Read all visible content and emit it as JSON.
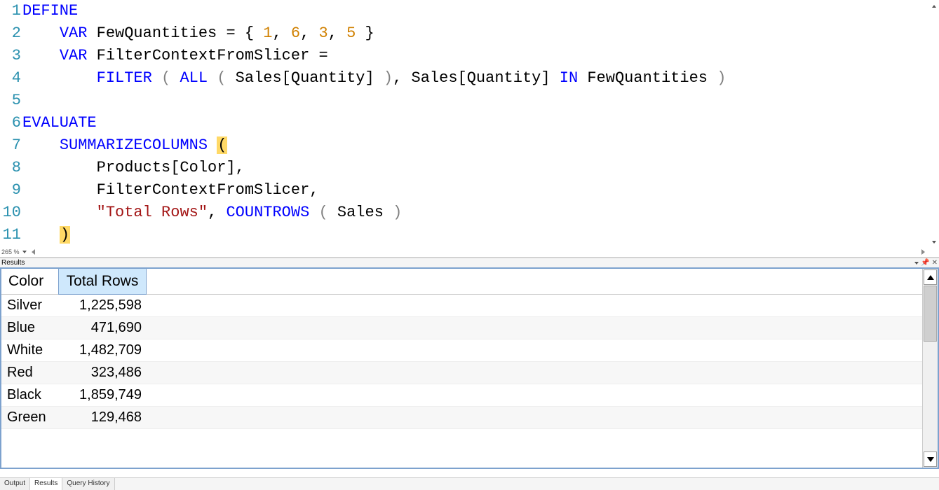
{
  "editor": {
    "zoom": "265 %",
    "lines": [
      {
        "n": 1,
        "tokens": [
          {
            "t": "DEFINE",
            "c": "kw"
          }
        ]
      },
      {
        "n": 2,
        "tokens": [
          {
            "t": "    ",
            "c": ""
          },
          {
            "t": "VAR",
            "c": "kw"
          },
          {
            "t": " FewQuantities = { ",
            "c": ""
          },
          {
            "t": "1",
            "c": "num"
          },
          {
            "t": ", ",
            "c": ""
          },
          {
            "t": "6",
            "c": "num"
          },
          {
            "t": ", ",
            "c": ""
          },
          {
            "t": "3",
            "c": "num"
          },
          {
            "t": ", ",
            "c": ""
          },
          {
            "t": "5",
            "c": "num"
          },
          {
            "t": " }",
            "c": ""
          }
        ]
      },
      {
        "n": 3,
        "tokens": [
          {
            "t": "    ",
            "c": ""
          },
          {
            "t": "VAR",
            "c": "kw"
          },
          {
            "t": " FilterContextFromSlicer =",
            "c": ""
          }
        ]
      },
      {
        "n": 4,
        "tokens": [
          {
            "t": "        ",
            "c": ""
          },
          {
            "t": "FILTER",
            "c": "fn"
          },
          {
            "t": " ",
            "c": ""
          },
          {
            "t": "(",
            "c": "br"
          },
          {
            "t": " ",
            "c": ""
          },
          {
            "t": "ALL",
            "c": "fn"
          },
          {
            "t": " ",
            "c": ""
          },
          {
            "t": "(",
            "c": "br"
          },
          {
            "t": " Sales[Quantity] ",
            "c": ""
          },
          {
            "t": ")",
            "c": "br"
          },
          {
            "t": ", Sales[Quantity] ",
            "c": ""
          },
          {
            "t": "IN",
            "c": "kw"
          },
          {
            "t": " FewQuantities ",
            "c": ""
          },
          {
            "t": ")",
            "c": "br"
          }
        ]
      },
      {
        "n": 5,
        "tokens": []
      },
      {
        "n": 6,
        "tokens": [
          {
            "t": "EVALUATE",
            "c": "kw"
          }
        ]
      },
      {
        "n": 7,
        "tokens": [
          {
            "t": "    ",
            "c": ""
          },
          {
            "t": "SUMMARIZECOLUMNS",
            "c": "fn"
          },
          {
            "t": " ",
            "c": ""
          },
          {
            "t": "(",
            "c": "match-br"
          }
        ]
      },
      {
        "n": 8,
        "tokens": [
          {
            "t": "        Products[Color],",
            "c": ""
          }
        ]
      },
      {
        "n": 9,
        "tokens": [
          {
            "t": "        FilterContextFromSlicer,",
            "c": ""
          }
        ]
      },
      {
        "n": 10,
        "tokens": [
          {
            "t": "        ",
            "c": ""
          },
          {
            "t": "\"Total Rows\"",
            "c": "str"
          },
          {
            "t": ", ",
            "c": ""
          },
          {
            "t": "COUNTROWS",
            "c": "fn"
          },
          {
            "t": " ",
            "c": ""
          },
          {
            "t": "(",
            "c": "br"
          },
          {
            "t": " Sales ",
            "c": ""
          },
          {
            "t": ")",
            "c": "br"
          }
        ]
      },
      {
        "n": 11,
        "tokens": [
          {
            "t": "    ",
            "c": ""
          },
          {
            "t": ")",
            "c": "match-br"
          }
        ]
      }
    ]
  },
  "results": {
    "title": "Results",
    "columns": [
      "Color",
      "Total Rows"
    ],
    "selected_col": 1,
    "rows": [
      {
        "color": "Silver",
        "total": "1,225,598"
      },
      {
        "color": "Blue",
        "total": "471,690"
      },
      {
        "color": "White",
        "total": "1,482,709"
      },
      {
        "color": "Red",
        "total": "323,486"
      },
      {
        "color": "Black",
        "total": "1,859,749"
      },
      {
        "color": "Green",
        "total": "129,468"
      }
    ]
  },
  "tabs": {
    "output": "Output",
    "results": "Results",
    "history": "Query History"
  }
}
